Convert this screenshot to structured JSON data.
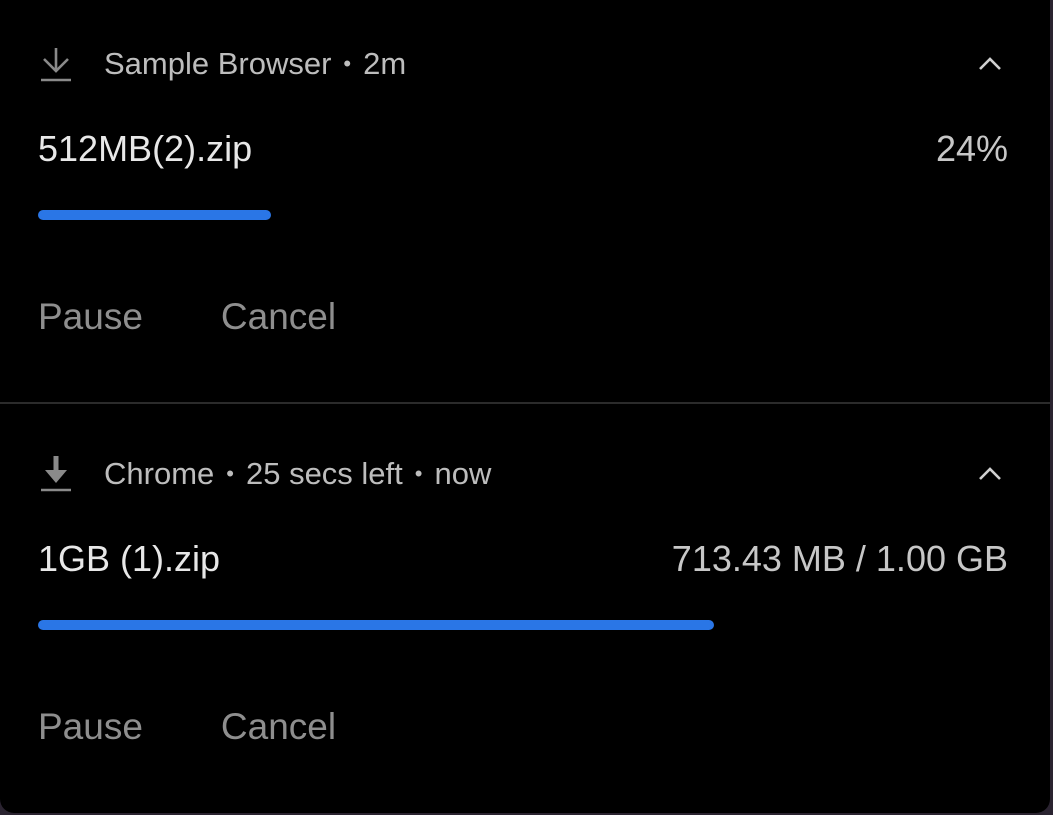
{
  "notifications": [
    {
      "app": "Sample Browser",
      "meta": [
        "2m"
      ],
      "icon": "download-outline-icon",
      "filename": "512MB(2).zip",
      "right_text": "24%",
      "progress": 0.24,
      "actions": {
        "pause": "Pause",
        "cancel": "Cancel"
      }
    },
    {
      "app": "Chrome",
      "meta": [
        "25 secs left",
        "now"
      ],
      "icon": "download-solid-icon",
      "filename": "1GB (1).zip",
      "right_text": "713.43 MB / 1.00 GB",
      "progress": 0.6967,
      "actions": {
        "pause": "Pause",
        "cancel": "Cancel"
      }
    }
  ],
  "separator": "•",
  "colors": {
    "background": "#000000",
    "progress": "#2a76e6",
    "muted_text": "#8e8e8e"
  }
}
